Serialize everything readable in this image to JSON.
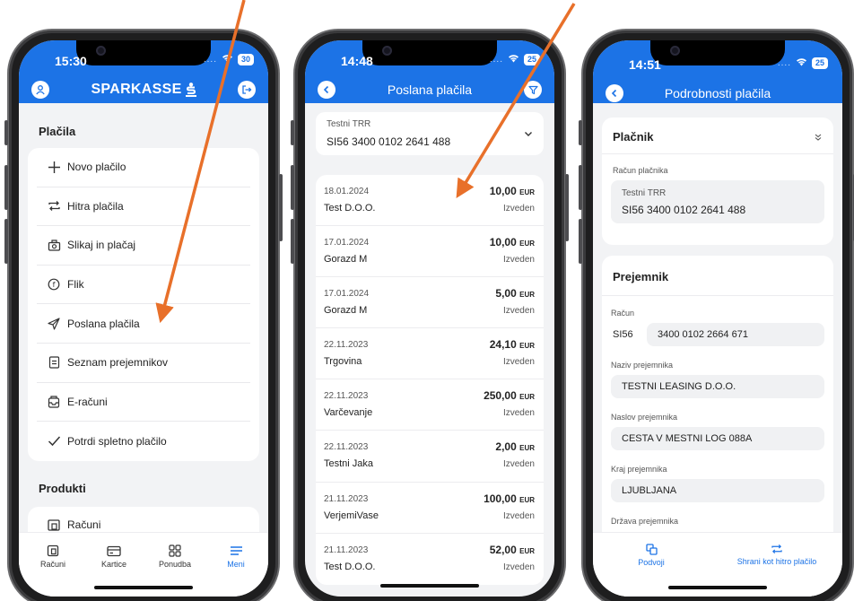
{
  "colors": {
    "brand": "#1c73e6",
    "arrow": "#e8702a"
  },
  "phone1": {
    "time": "15:30",
    "battery": "30",
    "logo": "SPARKASSE",
    "section_payments": "Plačila",
    "menu": [
      {
        "icon": "plus-icon",
        "label": "Novo plačilo"
      },
      {
        "icon": "repeat-icon",
        "label": "Hitra plačila"
      },
      {
        "icon": "camera-icon",
        "label": "Slikaj in plačaj"
      },
      {
        "icon": "flik-icon",
        "label": "Flik"
      },
      {
        "icon": "send-icon",
        "label": "Poslana plačila"
      },
      {
        "icon": "list-icon",
        "label": "Seznam prejemnikov"
      },
      {
        "icon": "inbox-icon",
        "label": "E-računi"
      },
      {
        "icon": "check-icon",
        "label": "Potrdi spletno plačilo"
      }
    ],
    "section_products": "Produkti",
    "products": [
      {
        "icon": "wallet-icon",
        "label": "Računi"
      }
    ],
    "tabs": [
      {
        "icon": "accounts-icon",
        "label": "Računi"
      },
      {
        "icon": "card-icon",
        "label": "Kartice"
      },
      {
        "icon": "grid-icon",
        "label": "Ponudba"
      },
      {
        "icon": "menu-icon",
        "label": "Meni"
      }
    ]
  },
  "phone2": {
    "time": "14:48",
    "battery": "25",
    "title": "Poslana plačila",
    "account_label": "Testni TRR",
    "account_number": "SI56 3400 0102 2641 488",
    "payments": [
      {
        "date": "18.01.2024",
        "name": "Test D.O.O.",
        "amount": "10,00",
        "currency": "EUR",
        "status": "Izveden"
      },
      {
        "date": "17.01.2024",
        "name": "Gorazd M",
        "amount": "10,00",
        "currency": "EUR",
        "status": "Izveden"
      },
      {
        "date": "17.01.2024",
        "name": "Gorazd M",
        "amount": "5,00",
        "currency": "EUR",
        "status": "Izveden"
      },
      {
        "date": "22.11.2023",
        "name": "Trgovina",
        "amount": "24,10",
        "currency": "EUR",
        "status": "Izveden"
      },
      {
        "date": "22.11.2023",
        "name": "Varčevanje",
        "amount": "250,00",
        "currency": "EUR",
        "status": "Izveden"
      },
      {
        "date": "22.11.2023",
        "name": "Testni Jaka",
        "amount": "2,00",
        "currency": "EUR",
        "status": "Izveden"
      },
      {
        "date": "21.11.2023",
        "name": "VerjemiVase",
        "amount": "100,00",
        "currency": "EUR",
        "status": "Izveden"
      },
      {
        "date": "21.11.2023",
        "name": "Test D.O.O.",
        "amount": "52,00",
        "currency": "EUR",
        "status": "Izveden"
      }
    ]
  },
  "phone3": {
    "time": "14:51",
    "battery": "25",
    "title": "Podrobnosti plačila",
    "payer_title": "Plačnik",
    "payer_account_label": "Račun plačnika",
    "payer_account_name": "Testni TRR",
    "payer_account_number": "SI56 3400 0102 2641 488",
    "recipient_title": "Prejemnik",
    "account_label": "Račun",
    "account_prefix": "SI56",
    "account_number": "3400 0102 2664 671",
    "name_label": "Naziv prejemnika",
    "name_value": "TESTNI LEASING D.O.O.",
    "address_label": "Naslov prejemnika",
    "address_value": "CESTA V MESTNI LOG 088A",
    "city_label": "Kraj prejemnika",
    "city_value": "LJUBLJANA",
    "country_label": "Država prejemnika",
    "duplicate_label": "Podvoji",
    "save_quick_label": "Shrani kot hitro plačilo"
  }
}
